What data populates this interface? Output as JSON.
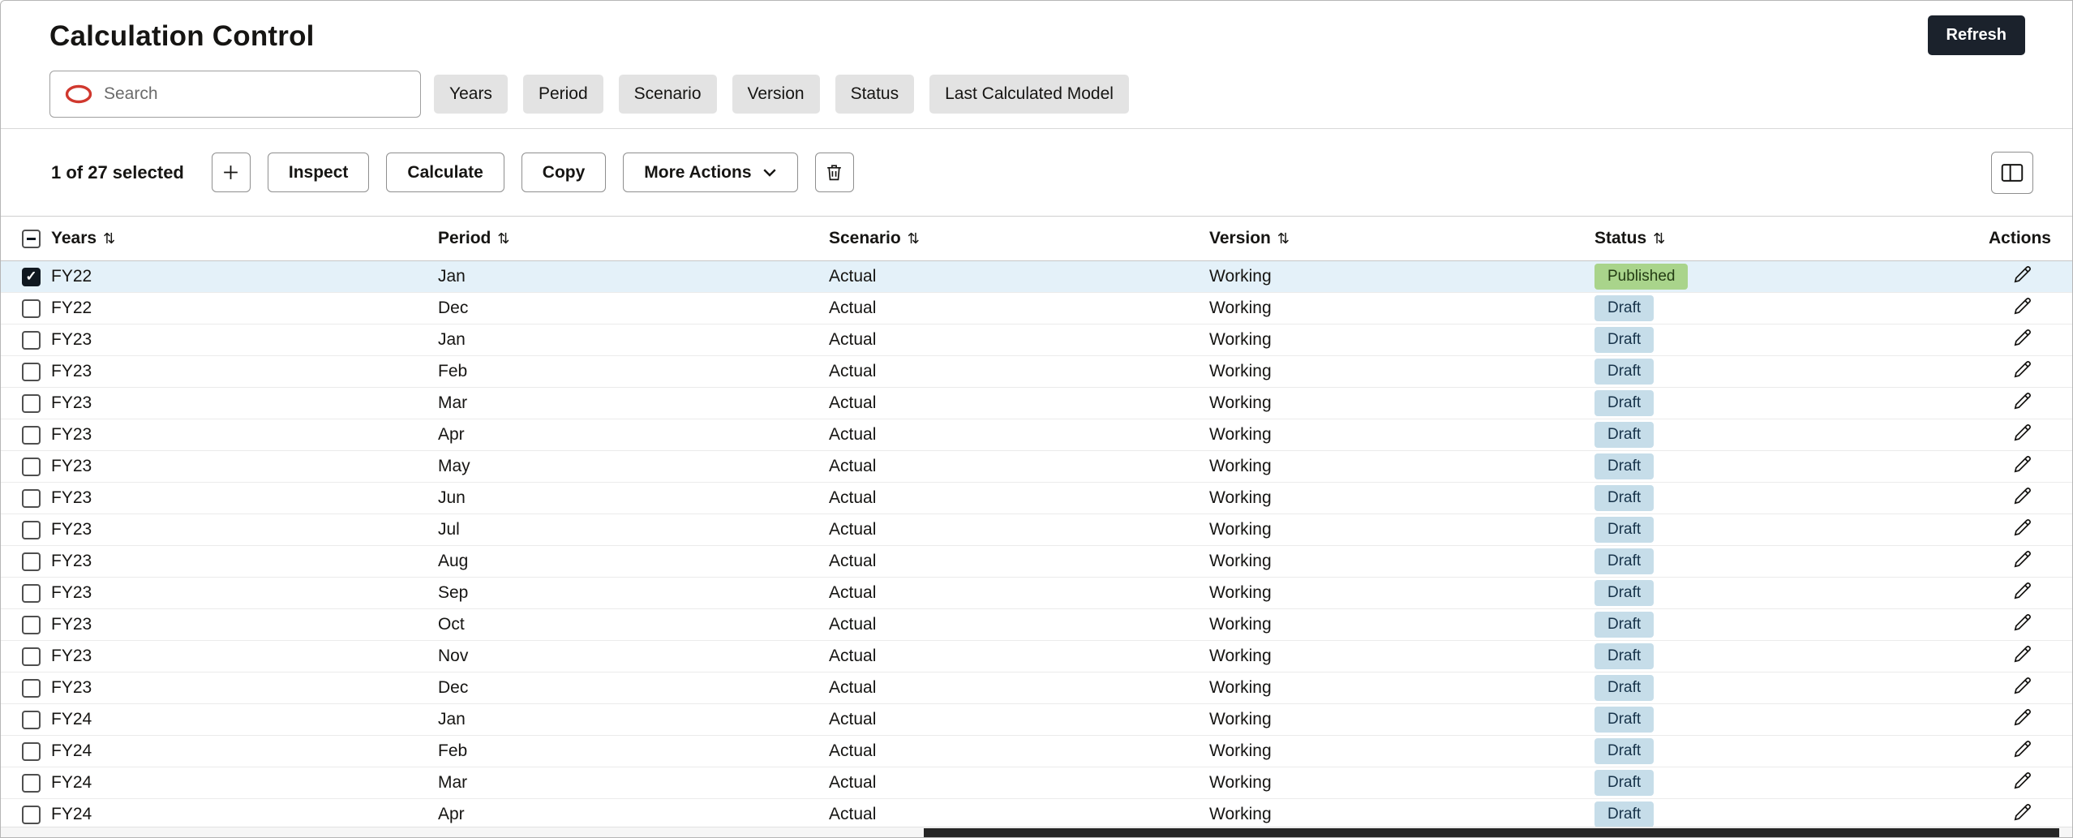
{
  "header": {
    "title": "Calculation Control",
    "refresh_label": "Refresh"
  },
  "search": {
    "placeholder": "Search"
  },
  "filters": [
    "Years",
    "Period",
    "Scenario",
    "Version",
    "Status",
    "Last Calculated Model"
  ],
  "toolbar": {
    "selected_text": "1 of 27 selected",
    "inspect_label": "Inspect",
    "calculate_label": "Calculate",
    "copy_label": "Copy",
    "more_actions_label": "More Actions"
  },
  "table": {
    "columns": [
      "Years",
      "Period",
      "Scenario",
      "Version",
      "Status"
    ],
    "actions_label": "Actions",
    "rows": [
      {
        "years": "FY22",
        "period": "Jan",
        "scenario": "Actual",
        "version": "Working",
        "status": "Published",
        "selected": true
      },
      {
        "years": "FY22",
        "period": "Dec",
        "scenario": "Actual",
        "version": "Working",
        "status": "Draft",
        "selected": false
      },
      {
        "years": "FY23",
        "period": "Jan",
        "scenario": "Actual",
        "version": "Working",
        "status": "Draft",
        "selected": false
      },
      {
        "years": "FY23",
        "period": "Feb",
        "scenario": "Actual",
        "version": "Working",
        "status": "Draft",
        "selected": false
      },
      {
        "years": "FY23",
        "period": "Mar",
        "scenario": "Actual",
        "version": "Working",
        "status": "Draft",
        "selected": false
      },
      {
        "years": "FY23",
        "period": "Apr",
        "scenario": "Actual",
        "version": "Working",
        "status": "Draft",
        "selected": false
      },
      {
        "years": "FY23",
        "period": "May",
        "scenario": "Actual",
        "version": "Working",
        "status": "Draft",
        "selected": false
      },
      {
        "years": "FY23",
        "period": "Jun",
        "scenario": "Actual",
        "version": "Working",
        "status": "Draft",
        "selected": false
      },
      {
        "years": "FY23",
        "period": "Jul",
        "scenario": "Actual",
        "version": "Working",
        "status": "Draft",
        "selected": false
      },
      {
        "years": "FY23",
        "period": "Aug",
        "scenario": "Actual",
        "version": "Working",
        "status": "Draft",
        "selected": false
      },
      {
        "years": "FY23",
        "period": "Sep",
        "scenario": "Actual",
        "version": "Working",
        "status": "Draft",
        "selected": false
      },
      {
        "years": "FY23",
        "period": "Oct",
        "scenario": "Actual",
        "version": "Working",
        "status": "Draft",
        "selected": false
      },
      {
        "years": "FY23",
        "period": "Nov",
        "scenario": "Actual",
        "version": "Working",
        "status": "Draft",
        "selected": false
      },
      {
        "years": "FY23",
        "period": "Dec",
        "scenario": "Actual",
        "version": "Working",
        "status": "Draft",
        "selected": false
      },
      {
        "years": "FY24",
        "period": "Jan",
        "scenario": "Actual",
        "version": "Working",
        "status": "Draft",
        "selected": false
      },
      {
        "years": "FY24",
        "period": "Feb",
        "scenario": "Actual",
        "version": "Working",
        "status": "Draft",
        "selected": false
      },
      {
        "years": "FY24",
        "period": "Mar",
        "scenario": "Actual",
        "version": "Working",
        "status": "Draft",
        "selected": false
      },
      {
        "years": "FY24",
        "period": "Apr",
        "scenario": "Actual",
        "version": "Working",
        "status": "Draft",
        "selected": false
      }
    ]
  },
  "colors": {
    "refresh_bg": "#1b222c",
    "oracle_red": "#d0382e",
    "published_badge_bg": "#a9d48b",
    "draft_badge_bg": "#c6dde9",
    "selected_row_bg": "#e4f1f9"
  }
}
